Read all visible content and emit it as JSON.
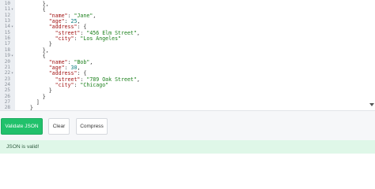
{
  "editor": {
    "lines": [
      {
        "n": "10",
        "fold": "",
        "indent": "        ",
        "parts": [
          {
            "t": "p",
            "v": "},"
          }
        ]
      },
      {
        "n": "11",
        "fold": "▾",
        "indent": "        ",
        "parts": [
          {
            "t": "p",
            "v": "{"
          }
        ]
      },
      {
        "n": "12",
        "fold": "",
        "indent": "          ",
        "parts": [
          {
            "t": "k",
            "v": "\"name\""
          },
          {
            "t": "p",
            "v": ": "
          },
          {
            "t": "s",
            "v": "\"Jane\""
          },
          {
            "t": "p",
            "v": ","
          }
        ]
      },
      {
        "n": "13",
        "fold": "",
        "indent": "          ",
        "parts": [
          {
            "t": "k",
            "v": "\"age\""
          },
          {
            "t": "p",
            "v": ": "
          },
          {
            "t": "n",
            "v": "25"
          },
          {
            "t": "p",
            "v": ","
          }
        ]
      },
      {
        "n": "14",
        "fold": "▾",
        "indent": "          ",
        "parts": [
          {
            "t": "k",
            "v": "\"address\""
          },
          {
            "t": "p",
            "v": ": {"
          }
        ]
      },
      {
        "n": "15",
        "fold": "",
        "indent": "            ",
        "parts": [
          {
            "t": "k",
            "v": "\"street\""
          },
          {
            "t": "p",
            "v": ": "
          },
          {
            "t": "s",
            "v": "\"456 Elm Street\""
          },
          {
            "t": "p",
            "v": ","
          }
        ]
      },
      {
        "n": "16",
        "fold": "",
        "indent": "            ",
        "parts": [
          {
            "t": "k",
            "v": "\"city\""
          },
          {
            "t": "p",
            "v": ": "
          },
          {
            "t": "s",
            "v": "\"Los Angeles\""
          }
        ]
      },
      {
        "n": "17",
        "fold": "",
        "indent": "          ",
        "parts": [
          {
            "t": "p",
            "v": "}"
          }
        ]
      },
      {
        "n": "18",
        "fold": "",
        "indent": "        ",
        "parts": [
          {
            "t": "p",
            "v": "},"
          }
        ]
      },
      {
        "n": "19",
        "fold": "▾",
        "indent": "        ",
        "parts": [
          {
            "t": "p",
            "v": "{"
          }
        ]
      },
      {
        "n": "20",
        "fold": "",
        "indent": "          ",
        "parts": [
          {
            "t": "k",
            "v": "\"name\""
          },
          {
            "t": "p",
            "v": ": "
          },
          {
            "t": "s",
            "v": "\"Bob\""
          },
          {
            "t": "p",
            "v": ","
          }
        ]
      },
      {
        "n": "21",
        "fold": "",
        "indent": "          ",
        "parts": [
          {
            "t": "k",
            "v": "\"age\""
          },
          {
            "t": "p",
            "v": ": "
          },
          {
            "t": "n",
            "v": "30"
          },
          {
            "t": "p",
            "v": ","
          }
        ]
      },
      {
        "n": "22",
        "fold": "▾",
        "indent": "          ",
        "parts": [
          {
            "t": "k",
            "v": "\"address\""
          },
          {
            "t": "p",
            "v": ": {"
          }
        ]
      },
      {
        "n": "23",
        "fold": "",
        "indent": "            ",
        "parts": [
          {
            "t": "k",
            "v": "\"street\""
          },
          {
            "t": "p",
            "v": ": "
          },
          {
            "t": "s",
            "v": "\"789 Oak Street\""
          },
          {
            "t": "p",
            "v": ","
          }
        ]
      },
      {
        "n": "24",
        "fold": "",
        "indent": "            ",
        "parts": [
          {
            "t": "k",
            "v": "\"city\""
          },
          {
            "t": "p",
            "v": ": "
          },
          {
            "t": "s",
            "v": "\"Chicago\""
          }
        ]
      },
      {
        "n": "25",
        "fold": "",
        "indent": "          ",
        "parts": [
          {
            "t": "p",
            "v": "}"
          }
        ]
      },
      {
        "n": "26",
        "fold": "",
        "indent": "        ",
        "parts": [
          {
            "t": "p",
            "v": "}"
          }
        ]
      },
      {
        "n": "27",
        "fold": "",
        "indent": "      ",
        "parts": [
          {
            "t": "p",
            "v": "]"
          }
        ]
      },
      {
        "n": "28",
        "fold": "",
        "indent": "    ",
        "parts": [
          {
            "t": "p",
            "v": "}"
          }
        ]
      }
    ]
  },
  "toolbar": {
    "validate_label": "Validate JSON",
    "clear_label": "Clear",
    "compress_label": "Compress"
  },
  "status": {
    "message": "JSON is valid!"
  },
  "colors": {
    "accent": "#21c16b",
    "status_bg": "#dff7e8",
    "json_key": "#a31515",
    "json_string": "#1a7f1a",
    "json_number": "#0b7d7d"
  },
  "icons": {
    "fold": "chevron-down-icon",
    "scroll": "scroll-down-arrow-icon"
  }
}
